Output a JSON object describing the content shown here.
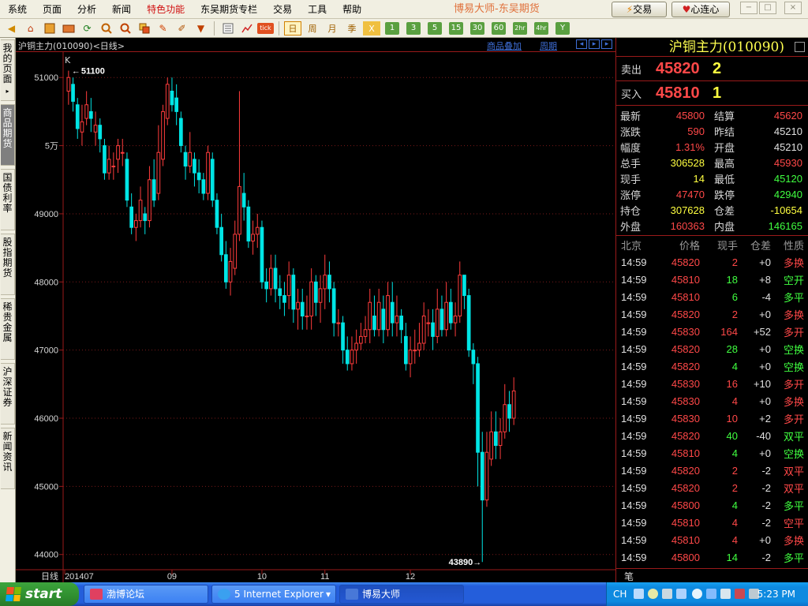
{
  "menubar": {
    "items": [
      "系统",
      "页面",
      "分析",
      "新闻",
      "特色功能",
      "东吴期货专栏",
      "交易",
      "工具",
      "帮助"
    ],
    "active_index": 4,
    "app_title": "博易大师-东吴期货",
    "trade_button": "交易",
    "heart_button": "心连心",
    "window_controls": [
      "−",
      "□",
      "×"
    ]
  },
  "toolbar": {
    "icons": [
      "back-arrow-icon",
      "home-icon",
      "book-icon",
      "wallet-icon",
      "refresh-icon",
      "zoom-in-icon",
      "zoom-out-icon",
      "window-icon",
      "pencil-icon",
      "brush-icon",
      "filter-icon",
      "list-icon",
      "line-chart-icon",
      "tick-icon"
    ],
    "periods": [
      "日",
      "周",
      "月",
      "季",
      "X",
      "1",
      "3",
      "5",
      "15",
      "30",
      "60",
      "2hr",
      "4hr",
      "Y"
    ],
    "selected_period": "日"
  },
  "left_tabs": [
    {
      "label": "我的页面",
      "active": false
    },
    {
      "label": "商品期货",
      "active": true
    },
    {
      "label": "国债利率",
      "active": false
    },
    {
      "label": "股指期货",
      "active": false
    },
    {
      "label": "稀贵金属",
      "active": false
    },
    {
      "label": "沪深证券",
      "active": false
    },
    {
      "label": "新闻资讯",
      "active": false
    }
  ],
  "chart_header": {
    "title": "沪铜主力(010090)<日线>",
    "overlay_link": "商品叠加",
    "period_link": "周期",
    "k_label": "K"
  },
  "chart_data": {
    "type": "candlestick",
    "ylim": [
      43800,
      51350
    ],
    "y_ticks": [
      {
        "value": 51000,
        "label": "51000"
      },
      {
        "value": 50000,
        "label": "5万"
      },
      {
        "value": 49000,
        "label": "49000"
      },
      {
        "value": 48000,
        "label": "48000"
      },
      {
        "value": 47000,
        "label": "47000"
      },
      {
        "value": 46000,
        "label": "46000"
      },
      {
        "value": 45000,
        "label": "45000"
      },
      {
        "value": 44000,
        "label": "44000"
      }
    ],
    "high_marker": {
      "value": 51100,
      "label": "51100"
    },
    "low_marker": {
      "value": 43890,
      "label": "43890"
    },
    "x_label_prefix": "日线",
    "x_ticks": [
      {
        "index": 0,
        "label": "201407"
      },
      {
        "index": 23,
        "label": "09"
      },
      {
        "index": 43,
        "label": "10"
      },
      {
        "index": 57,
        "label": "11"
      },
      {
        "index": 76,
        "label": "12"
      }
    ],
    "up_color": "#ff3c3c",
    "down_color": "#00e5e5",
    "candles": [
      [
        50800,
        51000,
        51100,
        50600
      ],
      [
        50900,
        50650,
        51000,
        50500
      ],
      [
        50600,
        50250,
        50700,
        50100
      ],
      [
        50200,
        50350,
        50600,
        50000
      ],
      [
        50400,
        50600,
        50800,
        50300
      ],
      [
        50500,
        50400,
        50700,
        50200
      ],
      [
        50200,
        50300,
        50500,
        50000
      ],
      [
        50300,
        50100,
        50400,
        49900
      ],
      [
        50000,
        49600,
        50100,
        49500
      ],
      [
        49600,
        49800,
        50000,
        49500
      ],
      [
        49700,
        49700,
        49900,
        49500
      ],
      [
        49800,
        50000,
        50100,
        49600
      ],
      [
        49900,
        49900,
        50100,
        49700
      ],
      [
        49800,
        49200,
        49900,
        49100
      ],
      [
        49100,
        48800,
        49300,
        48700
      ],
      [
        48800,
        48900,
        49000,
        48600
      ],
      [
        48900,
        49200,
        49400,
        48800
      ],
      [
        49000,
        48900,
        49100,
        48700
      ],
      [
        48900,
        49500,
        49700,
        48800
      ],
      [
        49500,
        49200,
        49800,
        49100
      ],
      [
        49300,
        49900,
        50300,
        49200
      ],
      [
        49800,
        50500,
        50600,
        49700
      ],
      [
        50400,
        50900,
        51000,
        50300
      ],
      [
        50800,
        50600,
        51000,
        50500
      ],
      [
        50700,
        50500,
        50900,
        50300
      ],
      [
        50400,
        50000,
        50500,
        49900
      ],
      [
        49900,
        49700,
        50000,
        49500
      ],
      [
        49700,
        49900,
        50200,
        49600
      ],
      [
        49800,
        49600,
        49900,
        49400
      ],
      [
        49600,
        49500,
        49800,
        49300
      ],
      [
        49500,
        49300,
        49600,
        49200
      ],
      [
        49300,
        49900,
        50000,
        49200
      ],
      [
        49800,
        49200,
        49900,
        49100
      ],
      [
        49200,
        48800,
        49300,
        48700
      ],
      [
        48800,
        48400,
        49000,
        48300
      ],
      [
        48400,
        48000,
        48600,
        47900
      ],
      [
        48000,
        48300,
        48500,
        47800
      ],
      [
        48200,
        48700,
        48900,
        48100
      ],
      [
        48700,
        49400,
        50800,
        48600
      ],
      [
        49300,
        49100,
        49600,
        48900
      ],
      [
        49100,
        48600,
        49200,
        48500
      ],
      [
        48600,
        48700,
        48900,
        48400
      ],
      [
        48700,
        48800,
        49000,
        48500
      ],
      [
        48800,
        48000,
        48900,
        47900
      ],
      [
        48000,
        47900,
        48200,
        47700
      ],
      [
        47900,
        48200,
        48400,
        47800
      ],
      [
        48200,
        47900,
        48400,
        47700
      ],
      [
        47900,
        47800,
        48100,
        47600
      ],
      [
        47800,
        47700,
        48000,
        47500
      ],
      [
        47800,
        48100,
        48300,
        47600
      ],
      [
        48100,
        47600,
        48200,
        47400
      ],
      [
        47600,
        47700,
        47900,
        47300
      ],
      [
        47700,
        47500,
        47900,
        47300
      ],
      [
        47500,
        47500,
        47800,
        47300
      ],
      [
        47500,
        48000,
        48200,
        47300
      ],
      [
        48000,
        47700,
        48100,
        47500
      ],
      [
        47700,
        47900,
        48100,
        47400
      ],
      [
        47900,
        48100,
        48400,
        47600
      ],
      [
        48100,
        47900,
        48300,
        47700
      ],
      [
        47900,
        47400,
        48000,
        47200
      ],
      [
        47400,
        47400,
        47600,
        47200
      ],
      [
        47400,
        47000,
        47500,
        46800
      ],
      [
        47000,
        46800,
        47200,
        46700
      ],
      [
        46800,
        47000,
        47200,
        46700
      ],
      [
        47000,
        47100,
        47300,
        46800
      ],
      [
        47100,
        47200,
        47400,
        47000
      ],
      [
        47200,
        47300,
        47500,
        47100
      ],
      [
        47300,
        47700,
        47900,
        47100
      ],
      [
        47500,
        47300,
        47800,
        47200
      ],
      [
        47300,
        47700,
        47900,
        47200
      ],
      [
        47600,
        47300,
        47800,
        47100
      ],
      [
        47300,
        47800,
        48000,
        47200
      ],
      [
        47700,
        47400,
        48000,
        47200
      ],
      [
        47400,
        47500,
        47800,
        47200
      ],
      [
        47500,
        47300,
        47600,
        47100
      ],
      [
        47200,
        46800,
        47400,
        46700
      ],
      [
        46800,
        47000,
        47200,
        46600
      ],
      [
        47000,
        47000,
        47300,
        46800
      ],
      [
        47000,
        47100,
        47400,
        46900
      ],
      [
        47100,
        47500,
        47700,
        47000
      ],
      [
        47400,
        47400,
        47600,
        47200
      ],
      [
        47400,
        47200,
        47600,
        47000
      ],
      [
        47200,
        47600,
        47900,
        47100
      ],
      [
        47600,
        47300,
        47800,
        47200
      ],
      [
        47300,
        47700,
        48000,
        47200
      ],
      [
        47700,
        47400,
        47900,
        47300
      ],
      [
        47400,
        47500,
        47700,
        47200
      ],
      [
        47500,
        48100,
        48300,
        47400
      ],
      [
        48100,
        47800,
        48100,
        47600
      ],
      [
        47800,
        47000,
        47900,
        46900
      ],
      [
        47000,
        46800,
        47100,
        46500
      ],
      [
        46800,
        45500,
        46900,
        45000
      ],
      [
        45500,
        44800,
        45800,
        43890
      ],
      [
        44800,
        45500,
        45800,
        44700
      ],
      [
        45400,
        45800,
        46100,
        45300
      ],
      [
        45800,
        45600,
        46100,
        45400
      ],
      [
        45600,
        45800,
        46000,
        45400
      ],
      [
        45800,
        46200,
        46500,
        45700
      ],
      [
        46200,
        46000,
        46400,
        45800
      ],
      [
        46000,
        46400,
        46600,
        45900
      ]
    ]
  },
  "quote": {
    "title": "沪铜主力(010090)",
    "sell_label": "卖出",
    "sell_price": "45820",
    "sell_vol": "2",
    "buy_label": "买入",
    "buy_price": "45810",
    "buy_vol": "1",
    "stats": [
      {
        "l1": "最新",
        "v1": "45800",
        "c1": "red",
        "l2": "结算",
        "v2": "45620",
        "c2": "red"
      },
      {
        "l1": "涨跌",
        "v1": "590",
        "c1": "red",
        "l2": "昨结",
        "v2": "45210",
        "c2": "wht"
      },
      {
        "l1": "幅度",
        "v1": "1.31%",
        "c1": "red",
        "l2": "开盘",
        "v2": "45210",
        "c2": "wht"
      },
      {
        "l1": "总手",
        "v1": "306528",
        "c1": "yel",
        "l2": "最高",
        "v2": "45930",
        "c2": "red"
      },
      {
        "l1": "现手",
        "v1": "14",
        "c1": "yel",
        "l2": "最低",
        "v2": "45120",
        "c2": "grn"
      },
      {
        "l1": "涨停",
        "v1": "47470",
        "c1": "red",
        "l2": "跌停",
        "v2": "42940",
        "c2": "grn"
      },
      {
        "l1": "持仓",
        "v1": "307628",
        "c1": "yel",
        "l2": "仓差",
        "v2": "-10654",
        "c2": "yel"
      },
      {
        "l1": "外盘",
        "v1": "160363",
        "c1": "red",
        "l2": "内盘",
        "v2": "146165",
        "c2": "grn"
      }
    ],
    "ticks_header": [
      "北京",
      "价格",
      "现手",
      "仓差",
      "性质"
    ],
    "ticks": [
      {
        "time": "14:59",
        "price": "45820",
        "vol": "2",
        "vc": "red",
        "oi": "+0",
        "nature": "多换",
        "nc": "red"
      },
      {
        "time": "14:59",
        "price": "45810",
        "vol": "18",
        "vc": "grn",
        "oi": "+8",
        "nature": "空开",
        "nc": "grn"
      },
      {
        "time": "14:59",
        "price": "45810",
        "vol": "6",
        "vc": "grn",
        "oi": "-4",
        "nature": "多平",
        "nc": "grn"
      },
      {
        "time": "14:59",
        "price": "45820",
        "vol": "2",
        "vc": "red",
        "oi": "+0",
        "nature": "多换",
        "nc": "red"
      },
      {
        "time": "14:59",
        "price": "45830",
        "vol": "164",
        "vc": "red",
        "oi": "+52",
        "nature": "多开",
        "nc": "red"
      },
      {
        "time": "14:59",
        "price": "45820",
        "vol": "28",
        "vc": "grn",
        "oi": "+0",
        "nature": "空换",
        "nc": "grn"
      },
      {
        "time": "14:59",
        "price": "45820",
        "vol": "4",
        "vc": "grn",
        "oi": "+0",
        "nature": "空换",
        "nc": "grn"
      },
      {
        "time": "14:59",
        "price": "45830",
        "vol": "16",
        "vc": "red",
        "oi": "+10",
        "nature": "多开",
        "nc": "red"
      },
      {
        "time": "14:59",
        "price": "45830",
        "vol": "4",
        "vc": "red",
        "oi": "+0",
        "nature": "多换",
        "nc": "red"
      },
      {
        "time": "14:59",
        "price": "45830",
        "vol": "10",
        "vc": "red",
        "oi": "+2",
        "nature": "多开",
        "nc": "red"
      },
      {
        "time": "14:59",
        "price": "45820",
        "vol": "40",
        "vc": "grn",
        "oi": "-40",
        "nature": "双平",
        "nc": "grn"
      },
      {
        "time": "14:59",
        "price": "45810",
        "vol": "4",
        "vc": "grn",
        "oi": "+0",
        "nature": "空换",
        "nc": "grn"
      },
      {
        "time": "14:59",
        "price": "45820",
        "vol": "2",
        "vc": "red",
        "oi": "-2",
        "nature": "双平",
        "nc": "red"
      },
      {
        "time": "14:59",
        "price": "45820",
        "vol": "2",
        "vc": "red",
        "oi": "-2",
        "nature": "双平",
        "nc": "red"
      },
      {
        "time": "14:59",
        "price": "45800",
        "vol": "4",
        "vc": "grn",
        "oi": "-2",
        "nature": "多平",
        "nc": "grn"
      },
      {
        "time": "14:59",
        "price": "45810",
        "vol": "4",
        "vc": "red",
        "oi": "-2",
        "nature": "空平",
        "nc": "red"
      },
      {
        "time": "14:59",
        "price": "45810",
        "vol": "4",
        "vc": "red",
        "oi": "+0",
        "nature": "多换",
        "nc": "red"
      },
      {
        "time": "14:59",
        "price": "45800",
        "vol": "14",
        "vc": "grn",
        "oi": "-2",
        "nature": "多平",
        "nc": "grn"
      }
    ],
    "bottom_tab": "笔"
  },
  "taskbar": {
    "start_label": "start",
    "tasks": [
      {
        "label": "渤博论坛",
        "active": false
      },
      {
        "label": "5 Internet Explorer",
        "active": false
      },
      {
        "label": "博易大师",
        "active": true
      }
    ],
    "lang": "CH",
    "clock": "5:23 PM"
  }
}
